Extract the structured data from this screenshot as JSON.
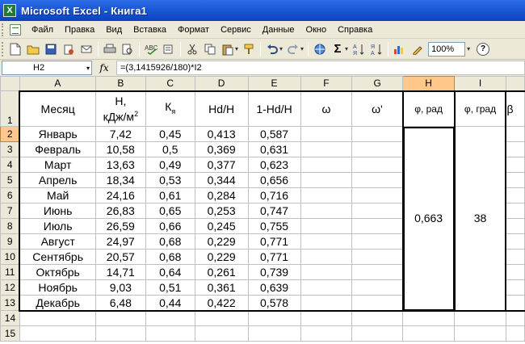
{
  "window": {
    "title": "Microsoft Excel - Книга1",
    "app_icon_letter": "X"
  },
  "menu": [
    "Файл",
    "Правка",
    "Вид",
    "Вставка",
    "Формат",
    "Сервис",
    "Данные",
    "Окно",
    "Справка"
  ],
  "toolbar": {
    "zoom": "100%",
    "help": "?"
  },
  "formula_bar": {
    "name_box": "H2",
    "fx": "fx",
    "formula": "=(3,1415926/180)*I2"
  },
  "columns": [
    "A",
    "B",
    "C",
    "D",
    "E",
    "F",
    "G",
    "H",
    "I"
  ],
  "rows": [
    "1",
    "2",
    "3",
    "4",
    "5",
    "6",
    "7",
    "8",
    "9",
    "10",
    "11",
    "12",
    "13",
    "14",
    "15"
  ],
  "headers": {
    "A": "Месяц",
    "B_line1": "H,",
    "B_line2": "кДж/м",
    "B_sup": "2",
    "C_main": "К",
    "C_sub": "я",
    "D": "Hd/H",
    "E": "1-Hd/H",
    "F": "ω",
    "G": "ω'",
    "H": "φ, рад",
    "I": "φ, град",
    "J": "β"
  },
  "data": [
    [
      "Январь",
      "7,42",
      "0,45",
      "0,413",
      "0,587"
    ],
    [
      "Февраль",
      "10,58",
      "0,5",
      "0,369",
      "0,631"
    ],
    [
      "Март",
      "13,63",
      "0,49",
      "0,377",
      "0,623"
    ],
    [
      "Апрель",
      "18,34",
      "0,53",
      "0,344",
      "0,656"
    ],
    [
      "Май",
      "24,16",
      "0,61",
      "0,284",
      "0,716"
    ],
    [
      "Июнь",
      "26,83",
      "0,65",
      "0,253",
      "0,747"
    ],
    [
      "Июль",
      "26,59",
      "0,66",
      "0,245",
      "0,755"
    ],
    [
      "Август",
      "24,97",
      "0,68",
      "0,229",
      "0,771"
    ],
    [
      "Сентябрь",
      "20,57",
      "0,68",
      "0,229",
      "0,771"
    ],
    [
      "Октябрь",
      "14,71",
      "0,64",
      "0,261",
      "0,739"
    ],
    [
      "Ноябрь",
      "9,03",
      "0,51",
      "0,361",
      "0,639"
    ],
    [
      "Декабрь",
      "6,48",
      "0,44",
      "0,422",
      "0,578"
    ]
  ],
  "merged": {
    "H": "0,663",
    "I": "38"
  }
}
